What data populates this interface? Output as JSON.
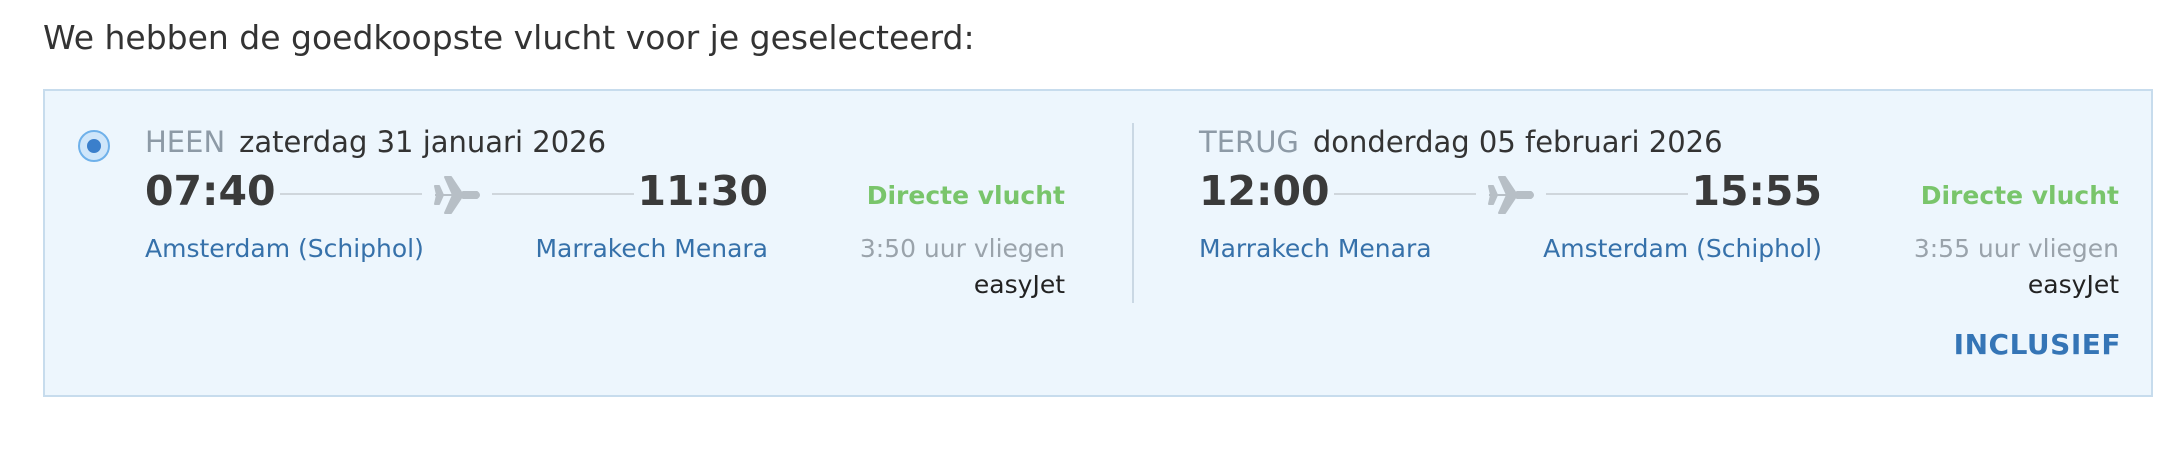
{
  "intro_text": "We hebben de goedkoopste vlucht voor je geselecteerd:",
  "option": {
    "selected": true,
    "inclusief_label": "INCLUSIEF",
    "outbound": {
      "direction": "HEEN",
      "date": "zaterdag 31 januari 2026",
      "departure_time": "07:40",
      "arrival_time": "11:30",
      "from_airport": "Amsterdam (Schiphol)",
      "to_airport": "Marrakech Menara",
      "flight_type": "Directe vlucht",
      "duration": "3:50 uur vliegen",
      "airline": "easyJet"
    },
    "return": {
      "direction": "TERUG",
      "date": "donderdag 05 februari 2026",
      "departure_time": "12:00",
      "arrival_time": "15:55",
      "from_airport": "Marrakech Menara",
      "to_airport": "Amsterdam (Schiphol)",
      "flight_type": "Directe vlucht",
      "duration": "3:55 uur vliegen",
      "airline": "easyJet"
    }
  },
  "icons": {
    "flight": "airplane-icon",
    "radio": "radio-selected-icon"
  },
  "colors": {
    "card_background": "#edf6fd",
    "card_border": "#c7dced",
    "accent_blue": "#3575b6",
    "direct_green": "#79c56b",
    "muted_gray": "#9aa3ab"
  }
}
